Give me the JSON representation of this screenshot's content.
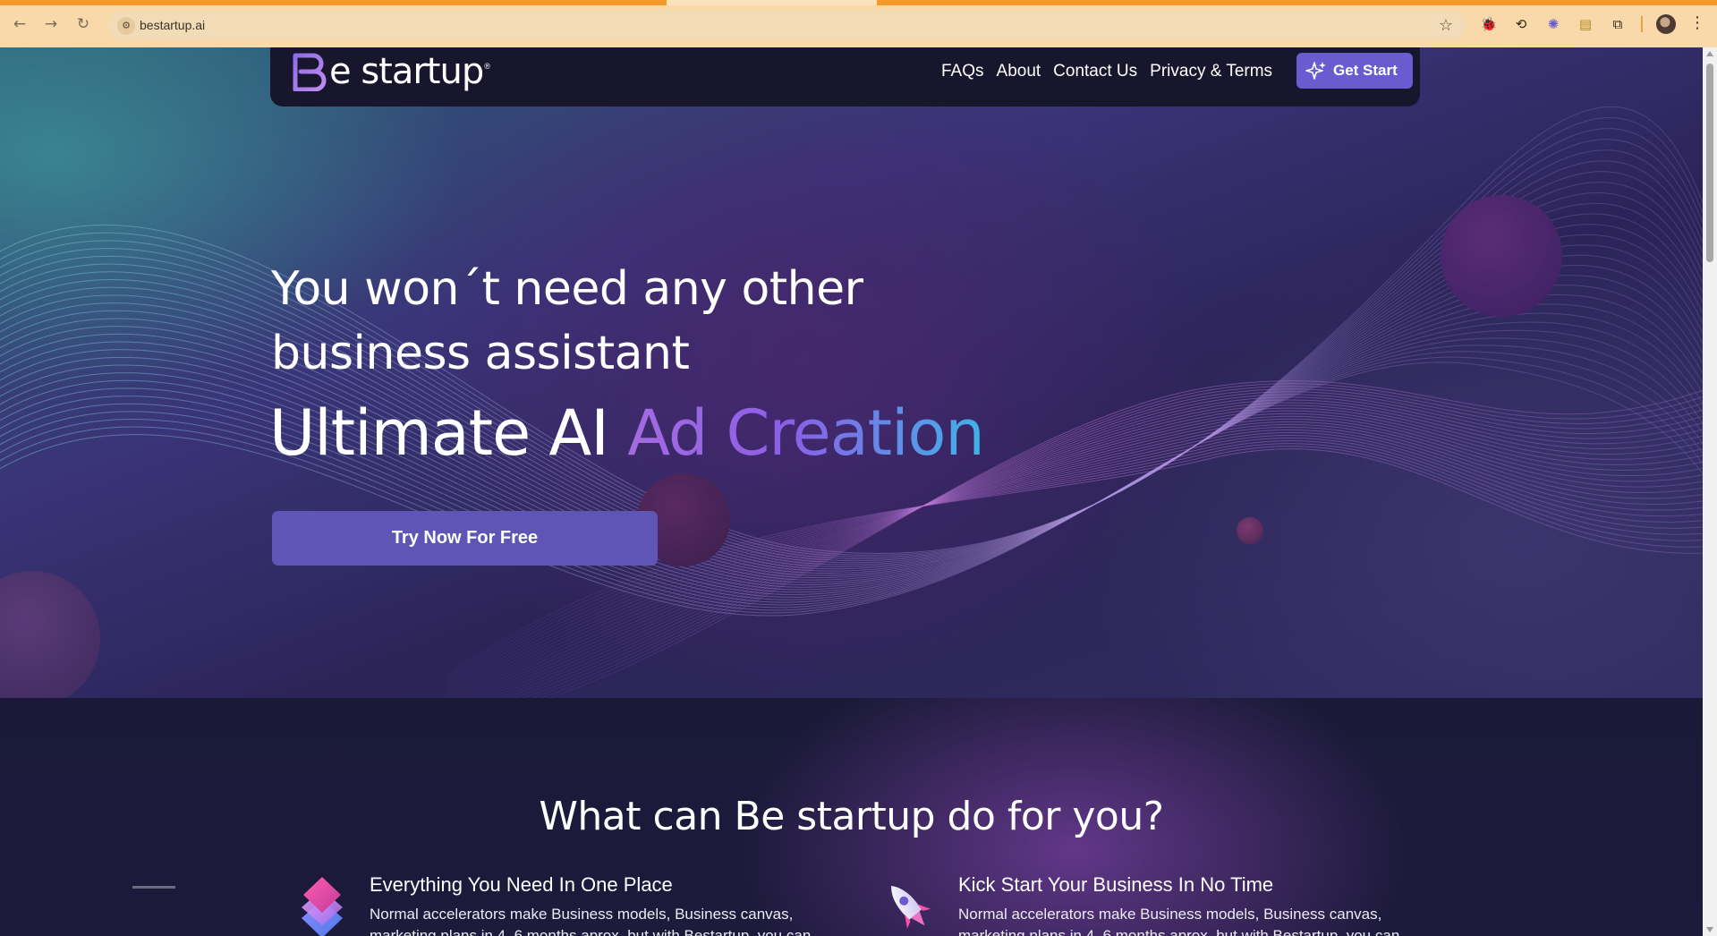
{
  "browser": {
    "url": "bestartup.ai",
    "back_icon": "back-arrow-icon",
    "forward_icon": "forward-arrow-icon",
    "reload_icon": "reload-icon",
    "site_info_icon": "tune-icon",
    "bookmark_icon": "star-icon",
    "extensions": [
      "extension-puzzle-icon",
      "sync-icon",
      "asterisk-icon",
      "wallet-icon",
      "extensions-icon"
    ]
  },
  "header": {
    "logo_text": "e startup",
    "logo_reg": "®",
    "nav": [
      "FAQs",
      "About",
      "Contact Us",
      "Privacy & Terms"
    ],
    "cta": "Get Start"
  },
  "hero": {
    "line1": "You won´t need any other",
    "line2": "business assistant",
    "big_plain": "Ultimate AI ",
    "big_gradient": "Ad Creation",
    "button": "Try Now For Free"
  },
  "section": {
    "title": "What can Be startup do for you?",
    "features": [
      {
        "title": "Everything You Need In One Place",
        "body": "Normal accelerators make Business models, Business canvas, marketing plans in 4–6 months aprox. but with Bestartup, you can have everything you need in under minutes",
        "icon": "layers-icon"
      },
      {
        "title": "Kick Start Your Business In No Time",
        "body": "Normal accelerators make Business models, Business canvas, marketing plans in 4–6 months aprox. but with Bestartup, you can have everything you need in under minutes",
        "icon": "rocket-icon"
      }
    ]
  },
  "colors": {
    "accent": "#6a5bd0",
    "button": "#5e55b6",
    "gradient_start": "#a56be0",
    "gradient_end": "#3fb3e8"
  }
}
